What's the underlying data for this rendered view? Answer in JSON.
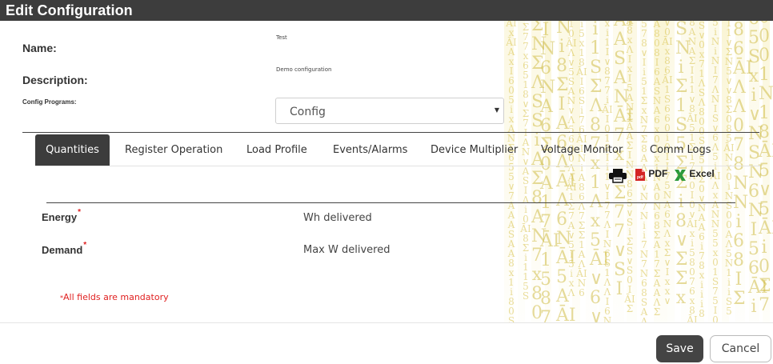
{
  "dialog": {
    "title": "Edit Configuration"
  },
  "form": {
    "name_label": "Name:",
    "name_value": "Test",
    "description_label": "Description:",
    "description_value": "Demo configuration",
    "config_programs_label": "Config Programs:",
    "config_programs_selected": "Config"
  },
  "tabs": [
    {
      "label": "Quantities",
      "active": true
    },
    {
      "label": "Register Operation",
      "active": false
    },
    {
      "label": "Load Profile",
      "active": false
    },
    {
      "label": "Events/Alarms",
      "active": false
    },
    {
      "label": "Device Multiplier",
      "active": false
    },
    {
      "label": "Voltage Monitor",
      "active": false
    },
    {
      "label": "Comm Logs",
      "active": false
    }
  ],
  "export": {
    "print_icon": "printer-icon",
    "pdf_label": "PDF",
    "excel_label": "Excel"
  },
  "fields": [
    {
      "label": "Energy",
      "required_mark": "*",
      "value": "Wh delivered"
    },
    {
      "label": "Demand",
      "required_mark": "*",
      "value": "Max W delivered"
    }
  ],
  "mandatory_note": {
    "mark": "*",
    "text": "All fields are mandatory"
  },
  "buttons": {
    "save": "Save",
    "cancel": "Cancel"
  },
  "colors": {
    "titlebar": "#3d3d3d",
    "active_tab": "#3c3c3c",
    "required": "#e02020",
    "matrix": "#d8c24a"
  }
}
